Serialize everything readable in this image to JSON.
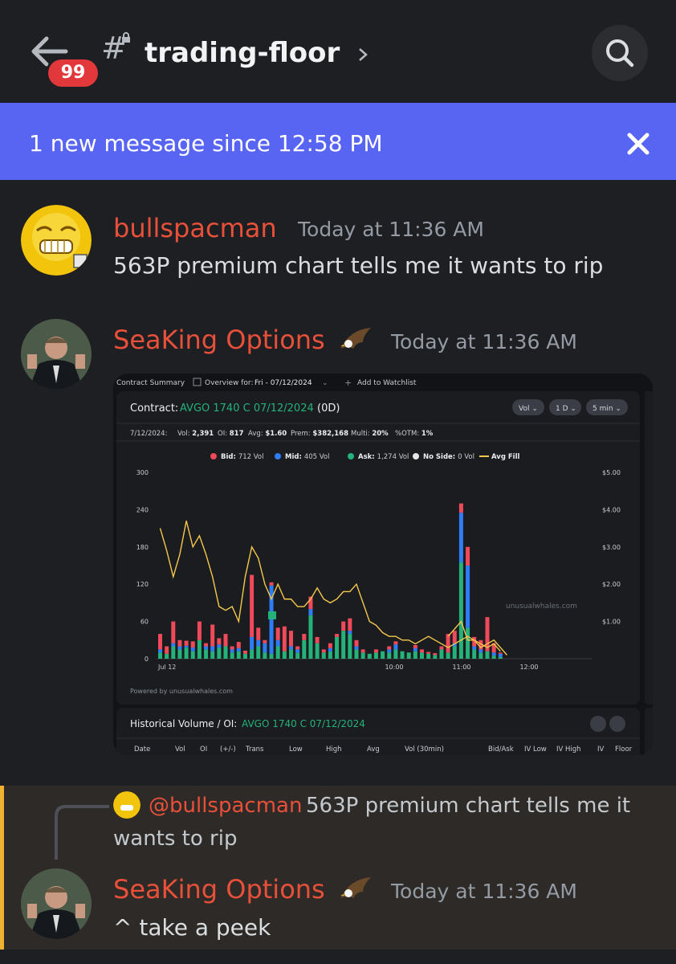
{
  "header": {
    "badge_count": "99",
    "channel_name": "trading-floor"
  },
  "banner": {
    "text": "1 new message since 12:58 PM"
  },
  "messages": [
    {
      "author": "bullspacman",
      "timestamp": "Today at 11:36 AM",
      "text": "563P premium chart tells me it wants to rip"
    },
    {
      "author": "SeaKing Options",
      "timestamp": "Today at 11:36 AM"
    },
    {
      "author": "SeaKing Options",
      "timestamp": "Today at 11:36 AM",
      "reply_author": "@bullspacman",
      "reply_text_line1": "563P premium chart tells me it",
      "reply_text_line2": "wants to rip",
      "text": "^ take a peek"
    }
  ],
  "embed": {
    "top_bar": {
      "tab": "Contract Summary",
      "overview_label": "Overview for:",
      "date_select": "Fri - 07/12/2024",
      "watchlist": "Add to Watchlist"
    },
    "contract_label": "Contract:",
    "contract_name": "AVGO 1740 C 07/12/2024",
    "contract_suffix": "(0D)",
    "controls": [
      "Vol",
      "1 D",
      "5 min"
    ],
    "stats": {
      "date": "7/12/2024:",
      "vol_label": "Vol:",
      "vol": "2,391",
      "oi_label": "OI:",
      "oi": "817",
      "avg_label": "Avg:",
      "avg": "$1.60",
      "prem_label": "Prem:",
      "prem": "$382,168",
      "multi_label": "Multi:",
      "multi": "20%",
      "otm_label": "%OTM:",
      "otm": "1%"
    },
    "powered_by": "Powered by unusualwhales.com",
    "watermark": "unusualwhales.com",
    "hist_title": "Historical Volume / OI:",
    "hist_contract": "AVGO 1740 C 07/12/2024",
    "hist_columns": [
      "Date",
      "Vol",
      "OI",
      "(+/-)",
      "Trans",
      "Low",
      "High",
      "Avg",
      "Vol (30min)",
      "Bid/Ask",
      "IV Low",
      "IV High",
      "IV",
      "Floor"
    ]
  },
  "chart_data": {
    "type": "bar",
    "legend": [
      {
        "name": "Bid:",
        "value": "712 Vol",
        "color": "#f0495a"
      },
      {
        "name": "Mid:",
        "value": "405 Vol",
        "color": "#2f7df6"
      },
      {
        "name": "Ask:",
        "value": "1,274 Vol",
        "color": "#25b27a"
      },
      {
        "name": "No Side:",
        "value": "0 Vol",
        "color": "#e6e6e6"
      },
      {
        "name": "Avg Fill",
        "value": "",
        "color": "#f5c84c"
      }
    ],
    "y_left_ticks": [
      "300",
      "240",
      "180",
      "120",
      "60",
      "0"
    ],
    "y_right_ticks": [
      "$5.00",
      "$4.00",
      "$3.00",
      "$2.00",
      "$1.00"
    ],
    "x_ticks": [
      "Jul 12",
      "10:00",
      "11:00",
      "12:00"
    ],
    "ylim_left": [
      0,
      300
    ],
    "ylim_right": [
      0,
      5
    ],
    "bars": [
      {
        "ask": 10,
        "mid": 5,
        "bid": 25
      },
      {
        "ask": 8,
        "mid": 0,
        "bid": 12
      },
      {
        "ask": 20,
        "mid": 5,
        "bid": 35
      },
      {
        "ask": 15,
        "mid": 5,
        "bid": 10
      },
      {
        "ask": 18,
        "mid": 3,
        "bid": 8
      },
      {
        "ask": 12,
        "mid": 6,
        "bid": 10
      },
      {
        "ask": 30,
        "mid": 0,
        "bid": 30
      },
      {
        "ask": 15,
        "mid": 5,
        "bid": 5
      },
      {
        "ask": 12,
        "mid": 8,
        "bid": 35
      },
      {
        "ask": 18,
        "mid": 5,
        "bid": 10
      },
      {
        "ask": 20,
        "mid": 0,
        "bid": 20
      },
      {
        "ask": 10,
        "mid": 5,
        "bid": 5
      },
      {
        "ask": 12,
        "mid": 5,
        "bid": 10
      },
      {
        "ask": 8,
        "mid": 0,
        "bid": 5
      },
      {
        "ask": 15,
        "mid": 20,
        "bid": 100
      },
      {
        "ask": 20,
        "mid": 10,
        "bid": 20
      },
      {
        "ask": 10,
        "mid": 15,
        "bid": 5
      },
      {
        "ask": 8,
        "mid": 110,
        "bid": 5
      },
      {
        "ask": 20,
        "mid": 10,
        "bid": 20
      },
      {
        "ask": 12,
        "mid": 0,
        "bid": 40
      },
      {
        "ask": 15,
        "mid": 5,
        "bid": 25
      },
      {
        "ask": 10,
        "mid": 5,
        "bid": 5
      },
      {
        "ask": 30,
        "mid": 0,
        "bid": 10
      },
      {
        "ask": 70,
        "mid": 10,
        "bid": 20
      },
      {
        "ask": 25,
        "mid": 0,
        "bid": 10
      },
      {
        "ask": 10,
        "mid": 0,
        "bid": 5
      },
      {
        "ask": 12,
        "mid": 5,
        "bid": 8
      },
      {
        "ask": 35,
        "mid": 0,
        "bid": 5
      },
      {
        "ask": 45,
        "mid": 0,
        "bid": 15
      },
      {
        "ask": 40,
        "mid": 5,
        "bid": 20
      },
      {
        "ask": 15,
        "mid": 5,
        "bid": 10
      },
      {
        "ask": 10,
        "mid": 0,
        "bid": 5
      },
      {
        "ask": 8,
        "mid": 0,
        "bid": 0
      },
      {
        "ask": 10,
        "mid": 0,
        "bid": 5
      },
      {
        "ask": 12,
        "mid": 0,
        "bid": 0
      },
      {
        "ask": 10,
        "mid": 5,
        "bid": 5
      },
      {
        "ask": 15,
        "mid": 8,
        "bid": 5
      },
      {
        "ask": 12,
        "mid": 0,
        "bid": 0
      },
      {
        "ask": 10,
        "mid": 0,
        "bid": 0
      },
      {
        "ask": 12,
        "mid": 5,
        "bid": 5
      },
      {
        "ask": 10,
        "mid": 0,
        "bid": 5
      },
      {
        "ask": 8,
        "mid": 0,
        "bid": 3
      },
      {
        "ask": 6,
        "mid": 0,
        "bid": 3
      },
      {
        "ask": 15,
        "mid": 0,
        "bid": 5
      },
      {
        "ask": 10,
        "mid": 0,
        "bid": 30
      },
      {
        "ask": 20,
        "mid": 5,
        "bid": 20
      },
      {
        "ask": 155,
        "mid": 80,
        "bid": 15
      },
      {
        "ask": 50,
        "mid": 100,
        "bid": 30
      },
      {
        "ask": 15,
        "mid": 5,
        "bid": 15
      },
      {
        "ask": 10,
        "mid": 5,
        "bid": 15
      },
      {
        "ask": 12,
        "mid": 0,
        "bid": 55
      },
      {
        "ask": 5,
        "mid": 5,
        "bid": 15
      },
      {
        "ask": 3,
        "mid": 5,
        "bid": 2
      }
    ],
    "avg_fill": [
      3.5,
      2.9,
      2.2,
      2.8,
      3.7,
      3.0,
      3.3,
      2.8,
      2.2,
      1.4,
      1.3,
      1.4,
      1.0,
      2.2,
      3.0,
      2.7,
      2.0,
      1.6,
      2.0,
      1.6,
      1.6,
      1.4,
      1.4,
      1.6,
      1.9,
      1.6,
      1.5,
      1.6,
      1.8,
      1.8,
      2.0,
      1.5,
      1.0,
      0.9,
      0.7,
      0.6,
      0.6,
      0.5,
      0.5,
      0.4,
      0.5,
      0.6,
      0.5,
      0.4,
      0.3,
      0.4,
      0.5,
      0.6,
      0.5,
      0.4,
      0.3,
      0.4,
      0.2
    ],
    "avg_fill_late": [
      0.6,
      0.8,
      1.0,
      0.5,
      0.5,
      0.3,
      0.4,
      0.5,
      0.3,
      0.1
    ]
  }
}
